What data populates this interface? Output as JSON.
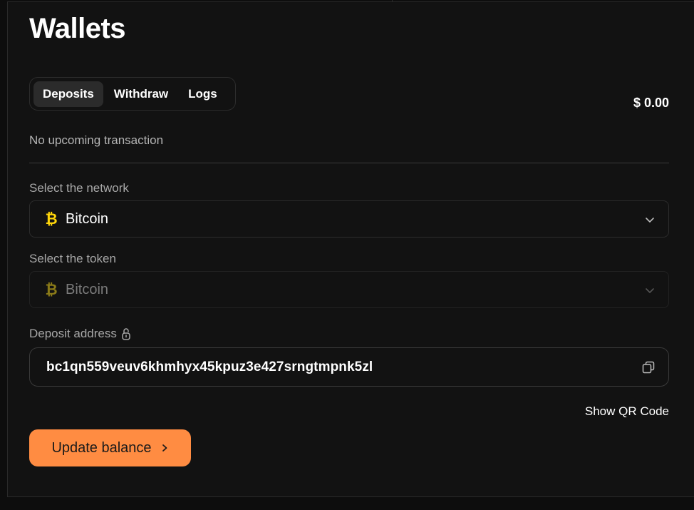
{
  "page": {
    "title": "Wallets"
  },
  "tabs": [
    {
      "label": "Deposits",
      "active": true
    },
    {
      "label": "Withdraw",
      "active": false
    },
    {
      "label": "Logs",
      "active": false
    }
  ],
  "balance": "$ 0.00",
  "upcoming": "No upcoming transaction",
  "network": {
    "label": "Select the network",
    "value": "Bitcoin",
    "icon": "bitcoin-icon"
  },
  "token": {
    "label": "Select the token",
    "value": "Bitcoin",
    "icon": "bitcoin-icon",
    "disabled": true
  },
  "deposit": {
    "label": "Deposit address",
    "lock_icon": "lock-icon",
    "address": "bc1qn559veuv6khmhyx45kpuz3e427srngtmpnk5zl",
    "copy_icon": "copy-icon"
  },
  "qr_link": "Show QR Code",
  "update_button": "Update balance",
  "colors": {
    "accent": "#ff8c42",
    "bitcoin": "#ffd60a",
    "background": "#121212"
  }
}
